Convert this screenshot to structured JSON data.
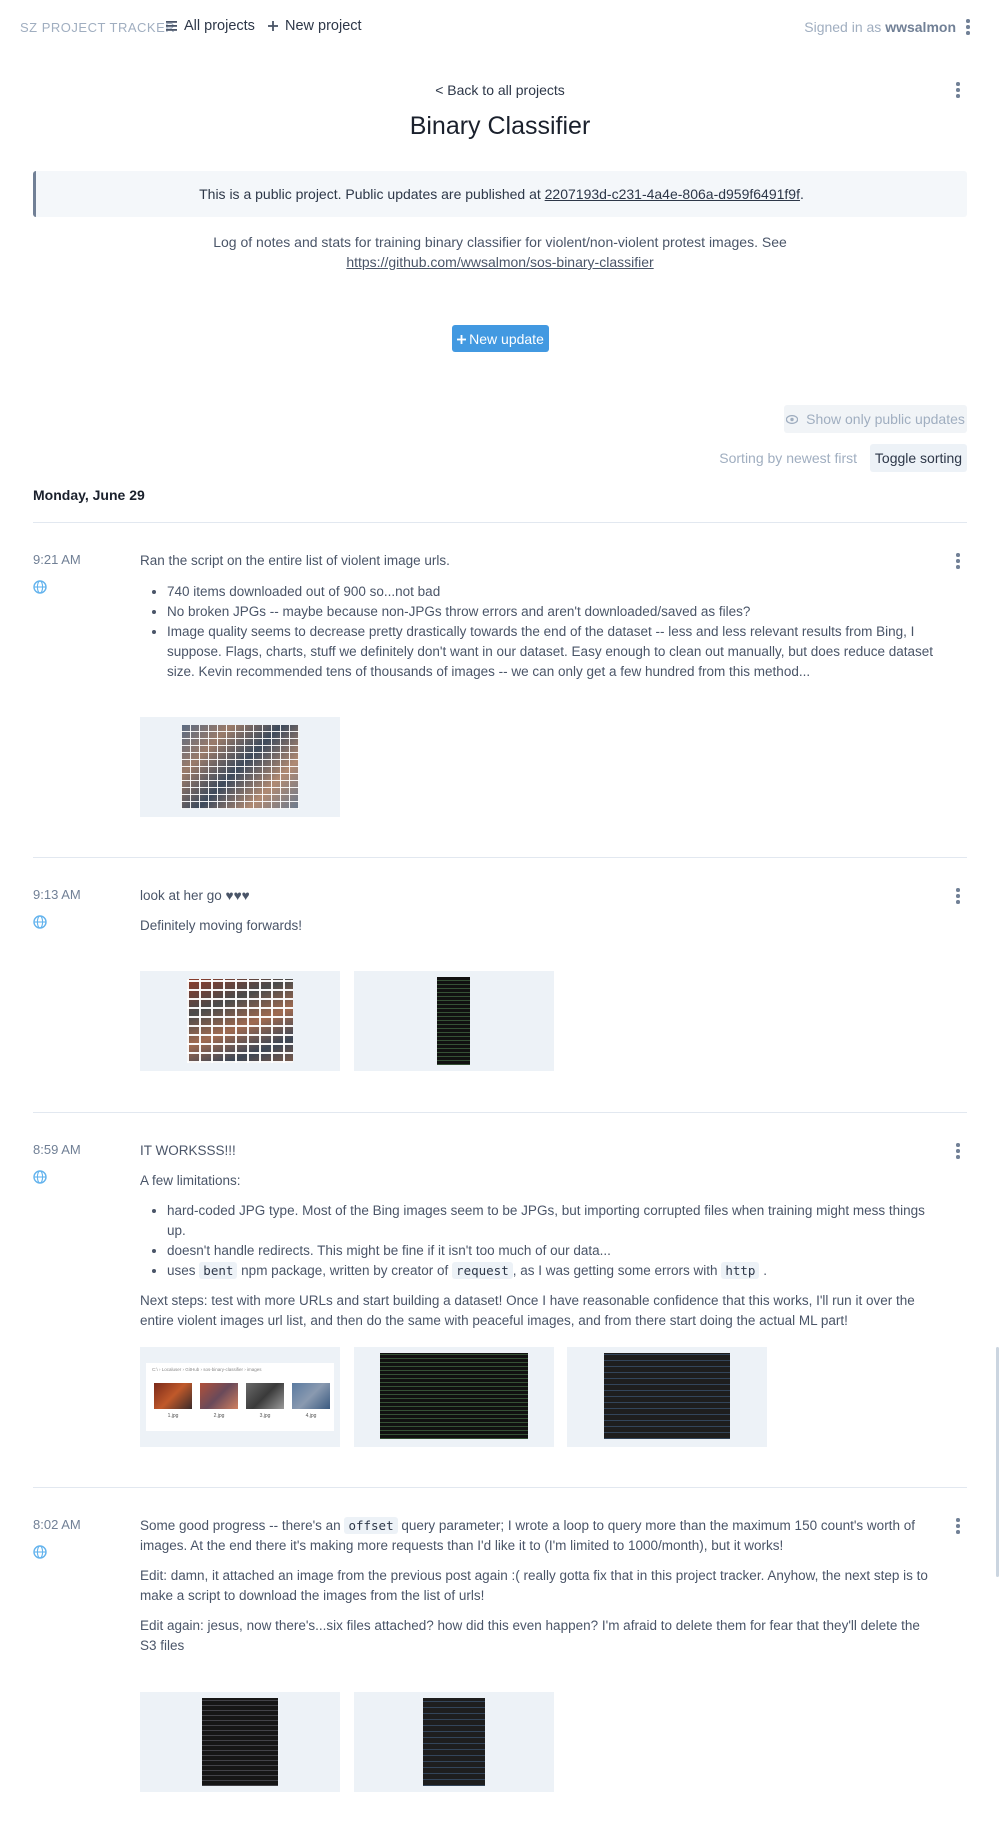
{
  "nav": {
    "brand": "SZ PROJECT TRACKER",
    "all_projects": "All projects",
    "new_project": "New project",
    "signed_in_prefix": "Signed in as",
    "username": "wwsalmon"
  },
  "project": {
    "back_link": "< Back to all projects",
    "title": "Binary Classifier",
    "public_notice_prefix": "This is a public project. Public updates are published at",
    "public_id": "2207193d-c231-4a4e-806a-d959f6491f9f",
    "public_notice_suffix": ".",
    "description": "Log of notes and stats for training binary classifier for violent/non-violent protest images. See",
    "description_link": "https://github.com/wwsalmon/sos-binary-classifier",
    "new_update_label": "New update",
    "filter_label": "Show only public updates",
    "sort_status": "Sorting by newest first",
    "sort_toggle": "Toggle sorting",
    "date_heading": "Monday, June 29"
  },
  "updates": [
    {
      "time": "9:21 AM",
      "paragraphs": [
        "Ran the script on the entire list of violent image urls."
      ],
      "bullets": [
        "740 items downloaded out of 900 so...not bad",
        "No broken JPGs -- maybe because non-JPGs throw errors and aren't downloaded/saved as files?",
        "Image quality seems to decrease pretty drastically towards the end of the dataset -- less and less relevant results from Bing, I suppose. Flags, charts, stuff we definitely don't want in our dataset. Easy enough to clean out manually, but does reduce dataset size. Kevin recommended tens of thousands of images -- we can only get a few hundred from this method..."
      ]
    },
    {
      "time": "9:13 AM",
      "title": "look at her go ♥♥♥",
      "paragraphs": [
        "Definitely moving forwards!"
      ]
    },
    {
      "time": "8:59 AM",
      "title": "IT WORKSSS!!!",
      "intro": "A few limitations:",
      "bullets": [
        "hard-coded JPG type. Most of the Bing images seem to be JPGs, but importing corrupted files when training might mess things up.",
        "doesn't handle redirects. This might be fine if it isn't too much of our data..."
      ],
      "bullet3": {
        "a": "uses",
        "code1": "bent",
        "b": "npm package, written by creator of",
        "code2": "request",
        "c": ", as I was getting some errors with",
        "code3": "http",
        "d": "."
      },
      "next_steps": "Next steps: test with more URLs and start building a dataset! Once I have reasonable confidence that this works, I'll run it over the entire violent images url list, and then do the same with peaceful images, and from there start doing the actual ML part!",
      "folder_breadcrumb": "C:\\ › Localuser › GitHub › sos-binary-classifier › images",
      "folder_captions": [
        "1.jpg",
        "2.jpg",
        "3.jpg",
        "4.jpg"
      ]
    },
    {
      "time": "8:02 AM",
      "p1_a": "Some good progress -- there's an",
      "p1_code": "offset",
      "p1_b": "query parameter; I wrote a loop to query more than the maximum 150 count's worth of images. At the end there it's making more requests than I'd like it to (I'm limited to 1000/month), but it works!",
      "p2": "Edit: damn, it attached an image from the previous post again :( really gotta fix that in this project tracker. Anyhow, the next step is to make a script to download the images from the list of urls!",
      "p3": "Edit again: jesus, now there's...six files attached? how did this even happen? I'm afraid to delete them for fear that they'll delete the S3 files"
    }
  ],
  "icons": {
    "menu": "list-icon",
    "plus": "plus-icon",
    "kebab": "kebab-menu-icon",
    "eye": "eye-icon",
    "globe": "globe-icon"
  },
  "colors": {
    "accent": "#4299e1",
    "globe": "#63b3ed",
    "text": "#4a5568"
  }
}
